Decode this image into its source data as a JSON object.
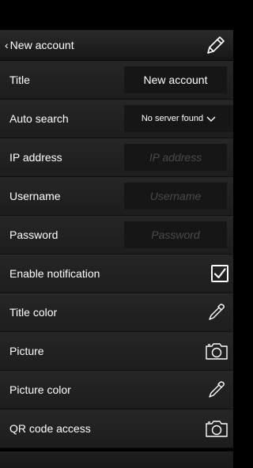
{
  "nav": {
    "back_label": "New account"
  },
  "form": {
    "title": {
      "label": "Title",
      "value": "New account"
    },
    "auto_search": {
      "label": "Auto search",
      "value": "No server found"
    },
    "ip_address": {
      "label": "IP address",
      "placeholder": "IP address"
    },
    "username": {
      "label": "Username",
      "placeholder": "Username"
    },
    "password": {
      "label": "Password",
      "placeholder": "Password"
    },
    "enable_notification": {
      "label": "Enable notification",
      "checked": true
    },
    "title_color": {
      "label": "Title color"
    },
    "picture": {
      "label": "Picture"
    },
    "picture_color": {
      "label": "Picture color"
    },
    "qr_code_access": {
      "label": "QR code access"
    }
  },
  "icons": {
    "edit": "pencil-icon",
    "back": "chevron-left-icon",
    "dropdown": "chevron-down-icon",
    "checkbox": "checkmark-icon",
    "title_color": "eyedropper-icon",
    "picture": "camera-icon",
    "picture_color": "eyedropper-icon",
    "qr_code_access": "camera-icon"
  },
  "colors": {
    "background": "#000000",
    "row": "#232323",
    "field": "#161616",
    "text": "#ffffff",
    "placeholder": "#4a4a4a"
  }
}
